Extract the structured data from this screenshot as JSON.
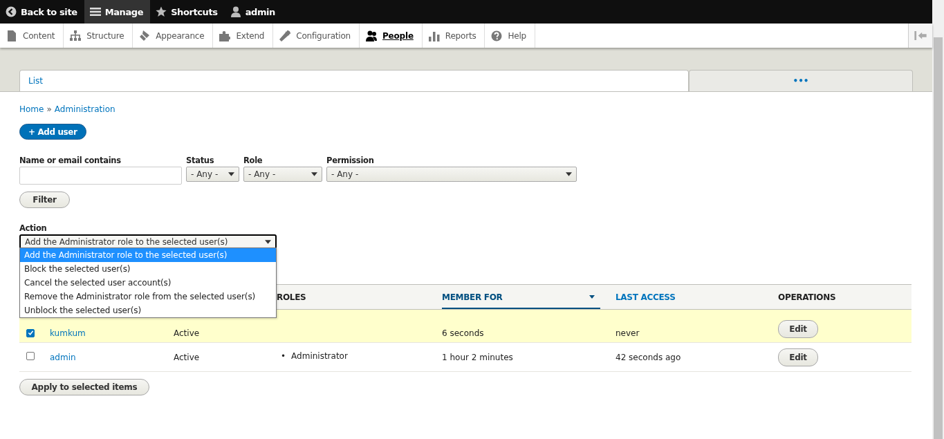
{
  "toolbar": [
    {
      "label": "Back to site",
      "selected": false
    },
    {
      "label": "Manage",
      "selected": true
    },
    {
      "label": "Shortcuts",
      "selected": false
    },
    {
      "label": "admin",
      "selected": false
    }
  ],
  "tray": [
    {
      "label": "Content",
      "selected": false
    },
    {
      "label": "Structure",
      "selected": false
    },
    {
      "label": "Appearance",
      "selected": false
    },
    {
      "label": "Extend",
      "selected": false
    },
    {
      "label": "Configuration",
      "selected": false
    },
    {
      "label": "People",
      "selected": true
    },
    {
      "label": "Reports",
      "selected": false
    },
    {
      "label": "Help",
      "selected": false
    }
  ],
  "tabs": [
    {
      "label": "List",
      "selected": true
    },
    {
      "label": "•••",
      "selected": false
    }
  ],
  "breadcrumb": {
    "items": [
      "Home",
      "Administration"
    ],
    "separator": "»"
  },
  "add_button": "+ Add user",
  "filters": [
    {
      "kind": "text",
      "label": "Name or email contains"
    },
    {
      "kind": "select",
      "label": "Status",
      "value": "- Any -"
    },
    {
      "kind": "select",
      "label": "Role",
      "value": "- Any -"
    },
    {
      "kind": "select",
      "label": "Permission",
      "value": "- Any -"
    }
  ],
  "filter_button": "Filter",
  "action": {
    "label": "Action",
    "value": "Add the Administrator role to the selected user(s)",
    "expanded": true,
    "options": [
      {
        "label": "Add the Administrator role to the selected user(s)",
        "selected": true
      },
      {
        "label": "Block the selected user(s)",
        "selected": false
      },
      {
        "label": "Cancel the selected user account(s)",
        "selected": false
      },
      {
        "label": "Remove the Administrator role from the selected user(s)",
        "selected": false
      },
      {
        "label": "Unblock the selected user(s)",
        "selected": false
      }
    ]
  },
  "table": {
    "columns": [
      {
        "label": "ROLES",
        "kind": "plain"
      },
      {
        "label": "MEMBER FOR",
        "kind": "sorted"
      },
      {
        "label": "LAST ACCESS",
        "kind": "link"
      },
      {
        "label": "OPERATIONS",
        "kind": "plain"
      }
    ],
    "rows": [
      {
        "selected": true,
        "checked": true,
        "username": "kumkum",
        "status": "Active",
        "member_for": "6 seconds",
        "last_access": "never",
        "operation": "Edit"
      },
      {
        "selected": false,
        "checked": false,
        "username": "admin",
        "status": "Active",
        "roles": [
          {
            "marker": "•",
            "label": "Administrator"
          }
        ],
        "member_for": "1 hour 2 minutes",
        "last_access": "42 seconds ago",
        "operation": "Edit"
      }
    ]
  },
  "apply_button": "Apply to selected items"
}
